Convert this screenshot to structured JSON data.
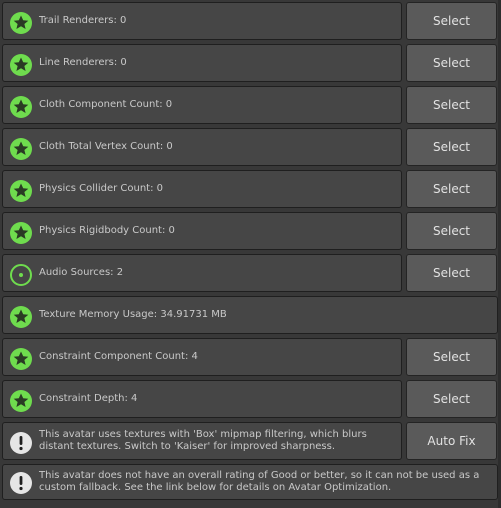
{
  "rows": [
    {
      "label": "Trail Renderers: 0",
      "icon": "star-icon",
      "button": "Select"
    },
    {
      "label": "Line Renderers: 0",
      "icon": "star-icon",
      "button": "Select"
    },
    {
      "label": "Cloth Component Count: 0",
      "icon": "star-icon",
      "button": "Select"
    },
    {
      "label": "Cloth Total Vertex Count: 0",
      "icon": "star-icon",
      "button": "Select"
    },
    {
      "label": "Physics Collider Count: 0",
      "icon": "star-icon",
      "button": "Select"
    },
    {
      "label": "Physics Rigidbody Count: 0",
      "icon": "star-icon",
      "button": "Select"
    },
    {
      "label": "Audio Sources: 2",
      "icon": "good-rating-icon",
      "button": "Select"
    },
    {
      "label": "Texture Memory Usage: 34.91731 MB",
      "icon": "star-icon"
    },
    {
      "label": "Constraint Component Count: 4",
      "icon": "star-icon",
      "button": "Select"
    },
    {
      "label": "Constraint Depth: 4",
      "icon": "star-icon",
      "button": "Select"
    },
    {
      "label": "This avatar uses textures with 'Box' mipmap filtering, which blurs distant textures. Switch to 'Kaiser' for improved sharpness.",
      "icon": "warning-icon",
      "button": "Auto Fix"
    },
    {
      "label": "This avatar does not have an overall rating of Good or better, so it can not be used as a custom fallback. See the link below for details on Avatar Optimization.",
      "icon": "warning-icon"
    }
  ],
  "colors": {
    "rating_green": "#6fdc4e",
    "warning_bg": "#e6e6e6"
  }
}
